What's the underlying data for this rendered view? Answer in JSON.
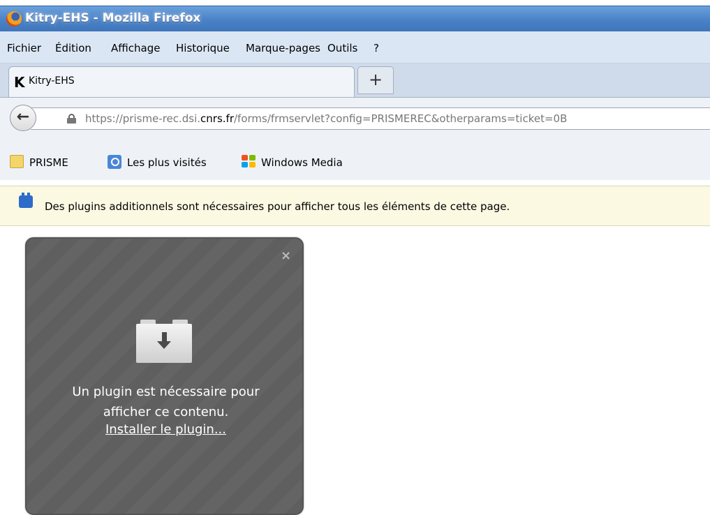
{
  "window": {
    "title": "Kitry-EHS - Mozilla Firefox"
  },
  "menu": [
    {
      "label": "Fichier",
      "name": "menu-fichier"
    },
    {
      "label": "Édition",
      "name": "menu-edition"
    },
    {
      "label": "Affichage",
      "name": "menu-affichage"
    },
    {
      "label": "Historique",
      "name": "menu-historique"
    },
    {
      "label": "Marque-pages",
      "name": "menu-marque-pages"
    },
    {
      "label": "Outils",
      "name": "menu-outils"
    },
    {
      "label": "?",
      "name": "menu-help"
    }
  ],
  "tabs": [
    {
      "label": "Kitry-EHS",
      "icon": "kitry-k-icon"
    }
  ],
  "new_tab_label": "+",
  "address": {
    "prefix": "https://prisme-rec.dsi.",
    "domain": "cnrs.fr",
    "suffix": "/forms/frmservlet?config=PRISMEREC&otherparams=ticket=0B"
  },
  "bookmarks": [
    {
      "label": "PRISME",
      "icon": "folder-icon"
    },
    {
      "label": "Les plus visités",
      "icon": "most-visited-icon"
    },
    {
      "label": "Windows Media",
      "icon": "windows-media-icon"
    }
  ],
  "notification": {
    "text": "Des plugins additionnels sont nécessaires pour afficher tous les éléments de cette page."
  },
  "plugin": {
    "close_label": "×",
    "message_line1": "Un plugin est nécessaire pour",
    "message_line2": "afficher ce contenu.",
    "install_link": "Installer le plugin..."
  },
  "colors": {
    "titlebar": "#4a82c6",
    "menubar": "#dbe6f4",
    "notification_bg": "#fbf9e2",
    "plugin_bg": "#5f5f5f"
  }
}
